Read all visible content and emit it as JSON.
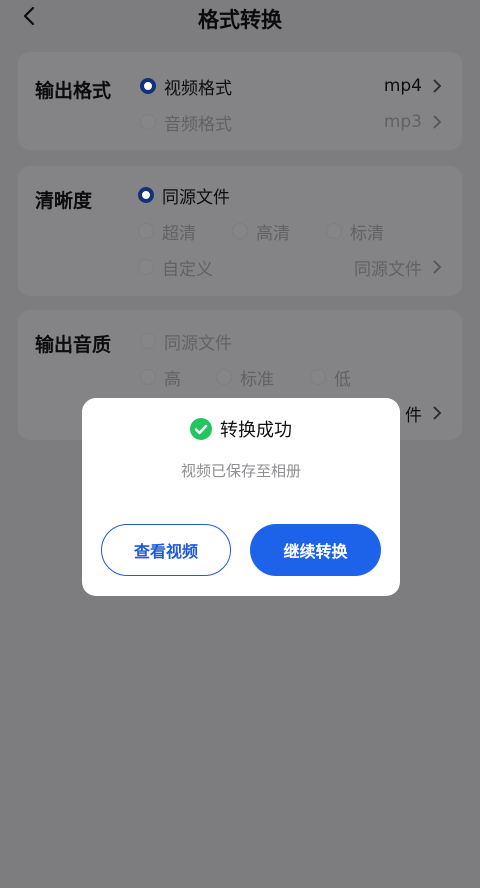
{
  "header": {
    "title": "格式转换"
  },
  "output_format": {
    "title": "输出格式",
    "options": [
      {
        "label": "视频格式",
        "selected": true,
        "value": "mp4"
      },
      {
        "label": "音频格式",
        "selected": false,
        "value": "mp3"
      }
    ]
  },
  "clarity": {
    "title": "清晰度",
    "same_source": "同源文件",
    "levels": [
      "超清",
      "高清",
      "标清"
    ],
    "custom": "自定义",
    "custom_value": "同源文件"
  },
  "audio_quality": {
    "title": "输出音质",
    "same_source": "同源文件",
    "levels": [
      "高",
      "标准",
      "低"
    ],
    "hidden_value_tail": "件"
  },
  "dialog": {
    "title": "转换成功",
    "message": "视频已保存至相册",
    "view_button": "查看视频",
    "continue_button": "继续转换"
  },
  "colors": {
    "primary": "#1d63ea",
    "success": "#22c55e",
    "overlay": "#7d7d80"
  }
}
